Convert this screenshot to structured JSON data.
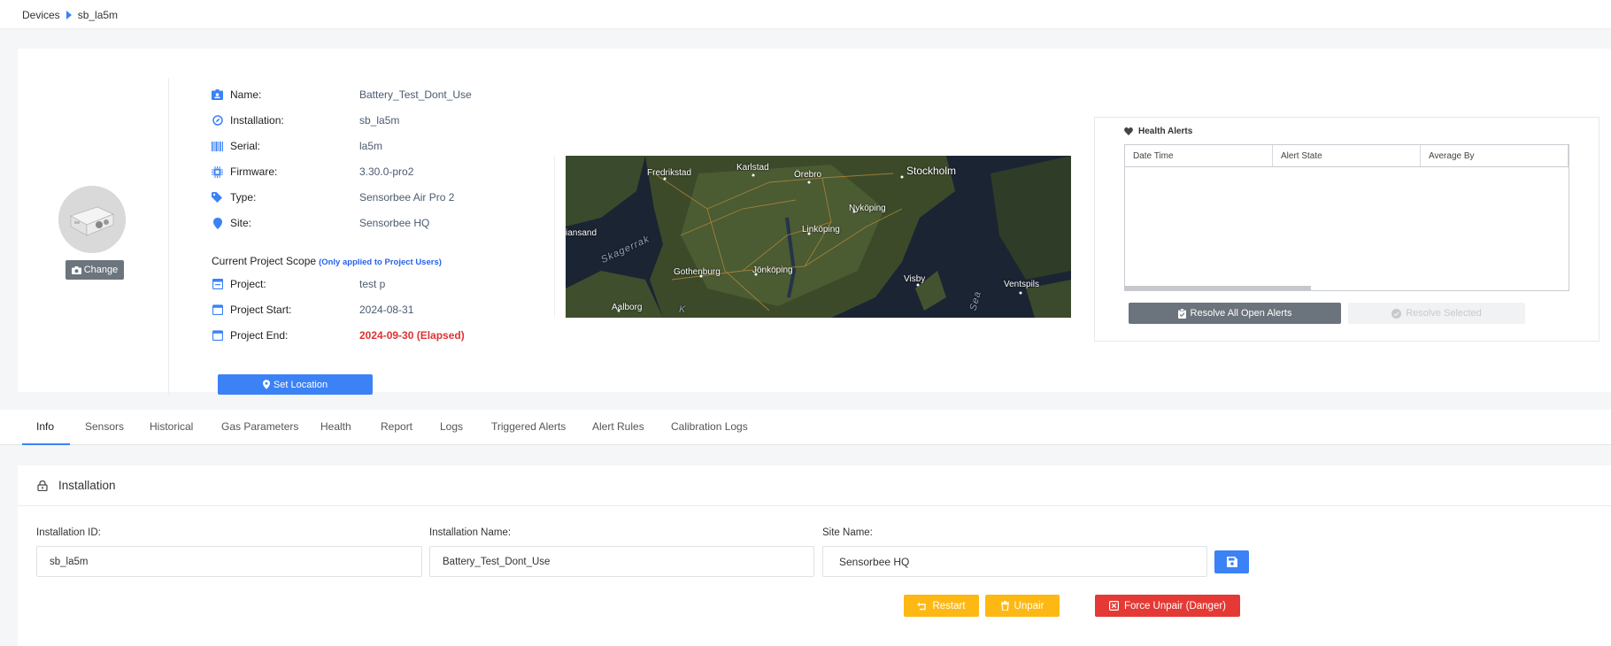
{
  "breadcrumb": {
    "root": "Devices",
    "current": "sb_la5m"
  },
  "device": {
    "change_label": "Change",
    "rows": [
      {
        "label": "Name:",
        "value": "Battery_Test_Dont_Use"
      },
      {
        "label": "Installation:",
        "value": "sb_la5m"
      },
      {
        "label": "Serial:",
        "value": "la5m"
      },
      {
        "label": "Firmware:",
        "value": "3.30.0-pro2"
      },
      {
        "label": "Type:",
        "value": "Sensorbee Air Pro 2"
      },
      {
        "label": "Site:",
        "value": "Sensorbee HQ"
      }
    ],
    "scope_title": "Current Project Scope",
    "scope_note": "(Only applied to Project Users)",
    "project_rows": [
      {
        "label": "Project:",
        "value": "test p"
      },
      {
        "label": "Project Start:",
        "value": "2024-08-31"
      },
      {
        "label": "Project End:",
        "value": "2024-09-30 (Elapsed)"
      }
    ],
    "set_location_label": "Set Location"
  },
  "map": {
    "labels": {
      "stockholm": "Stockholm",
      "karlstad": "Karlstad",
      "orebro": "Örebro",
      "fredrikstad": "Fredrikstad",
      "nykoping": "Nyköping",
      "linkoping": "Linköping",
      "kristiansand": "iansand",
      "skagerrak": "Skagerrak",
      "gothenburg": "Gothenburg",
      "jonkoping": "Jönköping",
      "visby": "Visby",
      "ventspils": "Ventspils",
      "aalborg": "Aalborg",
      "sea": "Sea",
      "k": "K"
    }
  },
  "health_alerts": {
    "title": "Health Alerts",
    "columns": [
      "Date Time",
      "Alert State",
      "Average By"
    ],
    "resolve_all_label": "Resolve All Open Alerts",
    "resolve_selected_label": "Resolve Selected"
  },
  "tabs": [
    "Info",
    "Sensors",
    "Historical",
    "Gas Parameters",
    "Health",
    "Report",
    "Logs",
    "Triggered Alerts",
    "Alert Rules",
    "Calibration Logs"
  ],
  "installation": {
    "title": "Installation",
    "id_label": "Installation ID:",
    "id_value": "sb_la5m",
    "name_label": "Installation Name:",
    "name_value": "Battery_Test_Dont_Use",
    "site_label": "Site Name:",
    "site_value": "Sensorbee HQ",
    "restart_label": "Restart",
    "unpair_label": "Unpair",
    "force_unpair_label": "Force Unpair (Danger)"
  },
  "colors": {
    "primary": "#3b82f6",
    "warning": "#fdb813",
    "danger": "#e53935",
    "secondary": "#6c757d",
    "elapsed": "#dd3333"
  }
}
